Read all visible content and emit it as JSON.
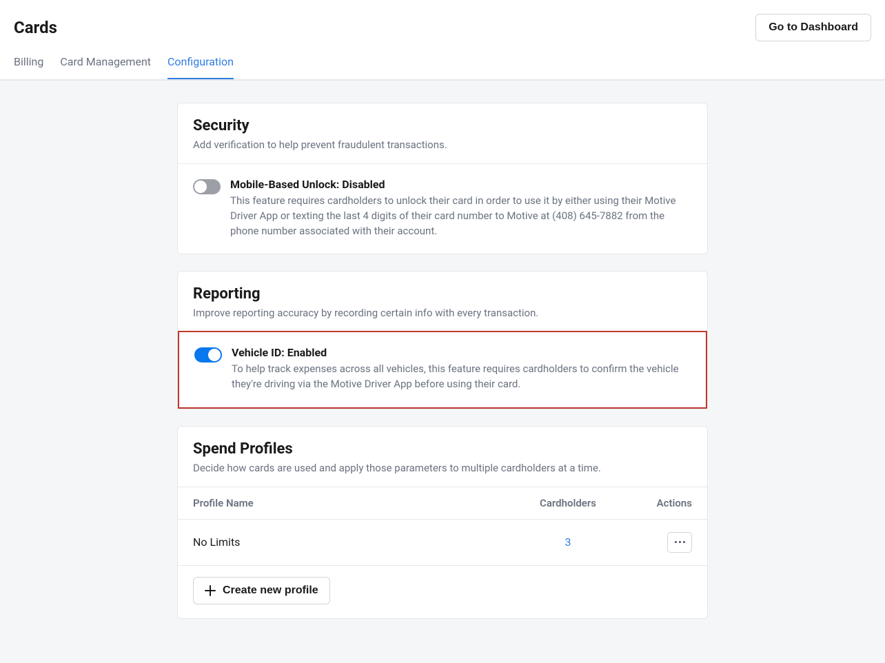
{
  "header": {
    "title": "Cards",
    "dashboard_btn": "Go to Dashboard"
  },
  "tabs": {
    "billing": "Billing",
    "card_management": "Card Management",
    "configuration": "Configuration"
  },
  "security": {
    "title": "Security",
    "subtitle": "Add verification to help prevent fraudulent transactions.",
    "unlock": {
      "title": "Mobile-Based Unlock: Disabled",
      "desc": "This feature requires cardholders to unlock their card in order to use it by either using their Motive Driver App or texting the last 4 digits of their card number to Motive at (408) 645-7882 from the phone number associated with their account."
    }
  },
  "reporting": {
    "title": "Reporting",
    "subtitle": "Improve reporting accuracy by recording certain info with every transaction.",
    "vehicle": {
      "title": "Vehicle ID: Enabled",
      "desc": "To help track expenses across all vehicles, this feature requires cardholders to confirm the vehicle they're driving via the Motive Driver App before using their card."
    }
  },
  "spend": {
    "title": "Spend Profiles",
    "subtitle": "Decide how cards are used and apply those parameters to multiple cardholders at a time.",
    "columns": {
      "name": "Profile Name",
      "holders": "Cardholders",
      "actions": "Actions"
    },
    "rows": [
      {
        "name": "No Limits",
        "holders": "3"
      }
    ],
    "create_btn": "Create new profile"
  }
}
